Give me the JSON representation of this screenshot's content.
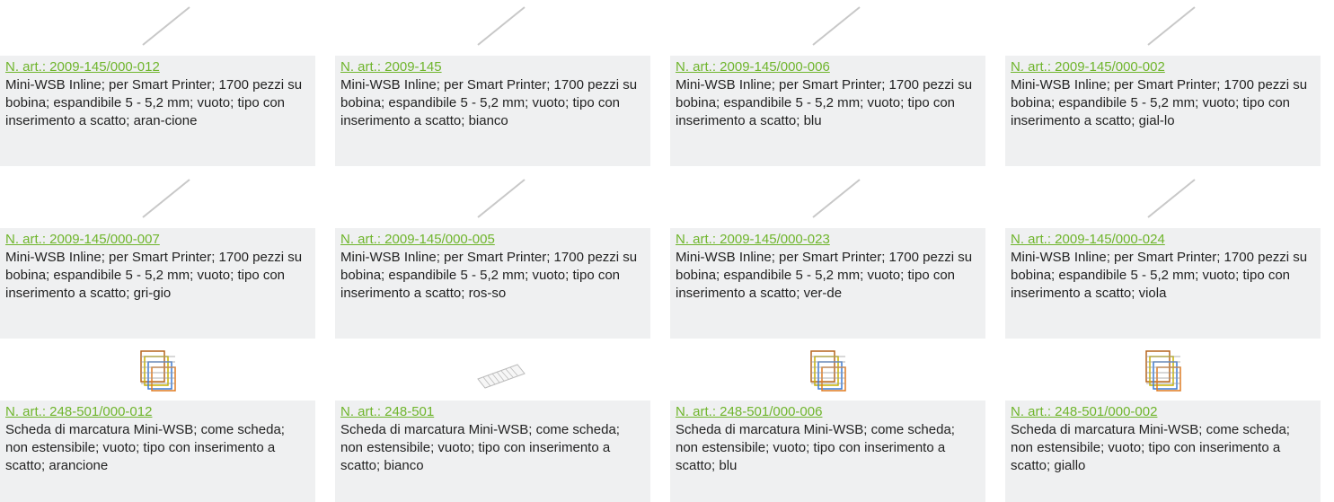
{
  "colors": {
    "link": "#6fb52c",
    "card_bg": "#eff0f1",
    "text": "#222222"
  },
  "rows": [
    {
      "thumb_icon": "strip-line-icon",
      "items": [
        {
          "art": "N. art.: 2009-145/000-012",
          "desc": "Mini-WSB Inline; per Smart Printer; 1700 pezzi su bobina; espandibile 5 - 5,2 mm; vuoto; tipo con inserimento a scatto; aran-cione"
        },
        {
          "art": "N. art.: 2009-145",
          "desc": "Mini-WSB Inline; per Smart Printer; 1700 pezzi su bobina; espandibile 5 - 5,2 mm; vuoto; tipo con inserimento a scatto; bianco"
        },
        {
          "art": "N. art.: 2009-145/000-006",
          "desc": "Mini-WSB Inline; per Smart Printer; 1700 pezzi su bobina; espandibile 5 - 5,2 mm; vuoto; tipo con inserimento a scatto; blu"
        },
        {
          "art": "N. art.: 2009-145/000-002",
          "desc": "Mini-WSB Inline; per Smart Printer; 1700 pezzi su bobina; espandibile 5 - 5,2 mm; vuoto; tipo con inserimento a scatto; gial-lo"
        }
      ]
    },
    {
      "thumb_icon": "strip-line-icon",
      "items": [
        {
          "art": "N. art.: 2009-145/000-007",
          "desc": "Mini-WSB Inline; per Smart Printer; 1700 pezzi su bobina; espandibile 5 - 5,2 mm; vuoto; tipo con inserimento a scatto; gri-gio"
        },
        {
          "art": "N. art.: 2009-145/000-005",
          "desc": "Mini-WSB Inline; per Smart Printer; 1700 pezzi su bobina; espandibile 5 - 5,2 mm; vuoto; tipo con inserimento a scatto; ros-so"
        },
        {
          "art": "N. art.: 2009-145/000-023",
          "desc": "Mini-WSB Inline; per Smart Printer; 1700 pezzi su bobina; espandibile 5 - 5,2 mm; vuoto; tipo con inserimento a scatto; ver-de"
        },
        {
          "art": "N. art.: 2009-145/000-024",
          "desc": "Mini-WSB Inline; per Smart Printer; 1700 pezzi su bobina; espandibile 5 - 5,2 mm; vuoto; tipo con inserimento a scatto; viola"
        }
      ]
    },
    {
      "thumb_icon": "marker-card-icon",
      "items": [
        {
          "art": "N. art.: 248-501/000-012",
          "desc": "Scheda di marcatura Mini-WSB; come scheda; non estensibile; vuoto; tipo con inserimento a scatto; arancione",
          "icon": "marker-card-stack-icon"
        },
        {
          "art": "N. art.: 248-501",
          "desc": "Scheda di marcatura Mini-WSB; come scheda; non estensibile; vuoto; tipo con inserimento a scatto; bianco",
          "icon": "marker-card-white-icon"
        },
        {
          "art": "N. art.: 248-501/000-006",
          "desc": "Scheda di marcatura Mini-WSB; come scheda; non estensibile; vuoto; tipo con inserimento a scatto; blu",
          "icon": "marker-card-stack-icon"
        },
        {
          "art": "N. art.: 248-501/000-002",
          "desc": "Scheda di marcatura Mini-WSB; come scheda; non estensibile; vuoto; tipo con inserimento a scatto; giallo",
          "icon": "marker-card-stack-icon"
        }
      ]
    }
  ]
}
